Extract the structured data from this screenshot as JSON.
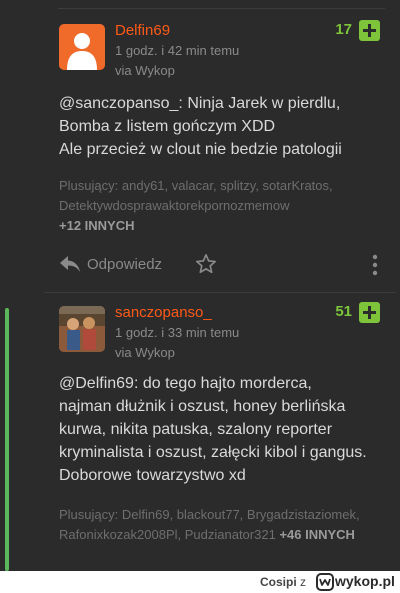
{
  "comments": [
    {
      "author": "Delfin69",
      "time": "1 godz. i 42 min temu",
      "via": "via Wykop",
      "score": "17",
      "body": "@sanczopanso_: Ninja Jarek w pierdlu,\nBomba z listem gończym XDD\nAle przecież w clout nie bedzie patologii",
      "voters_label": "Plusujący:",
      "voters": "andy61, valacar, splitzy, sotarKratos, Detektywdosprawaktorekpornozmemow",
      "voters_more": "+12 INNYCH",
      "reply_label": "Odpowiedz"
    },
    {
      "author": "sanczopanso_",
      "time": "1 godz. i 33 min temu",
      "via": "via Wykop",
      "score": "51",
      "body": "@Delfin69: do tego hajto morderca,\nnajman dłużnik i oszust, honey berlińska\nkurwa, nikita patuska, szalony reporter\nkryminalista i oszust, załęcki kibol i gangus.\nDoborowe towarzystwo xd",
      "voters_label": "Plusujący:",
      "voters": "Delfin69, blackout77, Brygadzistaziomek, Rafonixkozak2008Pl, Pudzianator321",
      "voters_more": "+46 INNYCH"
    }
  ],
  "footer": {
    "user": "Cosipi",
    "z": "z",
    "brand": "wykop.pl"
  },
  "colors": {
    "background": "#2b2b2b",
    "author": "#ff5917",
    "score": "#7dc43b",
    "rail": "#5cb85c"
  },
  "icons": [
    "reply-icon",
    "star-icon",
    "more-dots-icon",
    "plus-icon",
    "wykop-logo-icon"
  ]
}
